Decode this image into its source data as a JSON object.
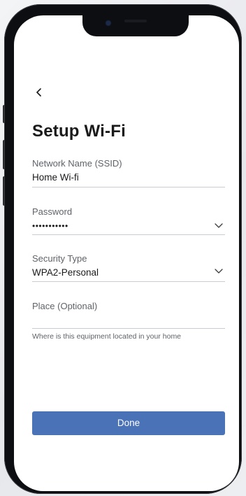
{
  "header": {
    "title": "Setup Wi-Fi"
  },
  "form": {
    "ssid": {
      "label": "Network Name (SSID)",
      "value": "Home Wi-fi"
    },
    "password": {
      "label": "Password",
      "value": "•••••••••••"
    },
    "security": {
      "label": "Security Type",
      "value": "WPA2-Personal"
    },
    "place": {
      "label": "Place (Optional)",
      "value": "",
      "hint": "Where is this equipment located in your home"
    }
  },
  "actions": {
    "done_label": "Done"
  },
  "colors": {
    "primary_button": "#4a72b6",
    "text": "#1a1a1a",
    "label": "#5f6368",
    "divider": "#c9ccd1"
  },
  "icons": {
    "back": "chevron-left-icon",
    "password_toggle": "chevron-down-icon",
    "security_dropdown": "chevron-down-icon"
  }
}
